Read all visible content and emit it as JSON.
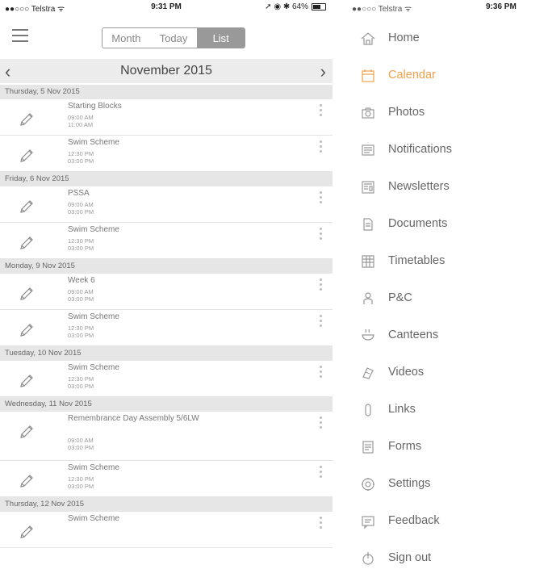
{
  "colors": {
    "accent": "#f0a04b",
    "header_bg": "#e6e6e6",
    "active_segment": "#999999"
  },
  "left": {
    "status": {
      "carrier": "●●○○○ Telstra ᯤ",
      "time": "9:31 PM",
      "right": "➚ ◉ ✱ 64%",
      "battery_level": 0.64
    },
    "segments": [
      {
        "label": "Month",
        "active": false
      },
      {
        "label": "Today",
        "active": false
      },
      {
        "label": "List",
        "active": true
      }
    ],
    "month": {
      "title": "November 2015",
      "prev": "‹",
      "next": "›"
    },
    "days": [
      {
        "header": "Thursday, 5 Nov 2015",
        "events": [
          {
            "title": "Starting Blocks",
            "start": "09:00 AM",
            "end": "11:00 AM"
          },
          {
            "title": "Swim Scheme",
            "start": "12:30 PM",
            "end": "03:00 PM"
          }
        ]
      },
      {
        "header": "Friday, 6 Nov 2015",
        "events": [
          {
            "title": "PSSA",
            "start": "09:00 AM",
            "end": "03:00 PM"
          },
          {
            "title": "Swim Scheme",
            "start": "12:30 PM",
            "end": "03:00 PM"
          }
        ]
      },
      {
        "header": "Monday, 9 Nov 2015",
        "events": [
          {
            "title": "Week 6",
            "start": "09:00 AM",
            "end": "03:00 PM"
          },
          {
            "title": "Swim Scheme",
            "start": "12:30 PM",
            "end": "03:00 PM"
          }
        ]
      },
      {
        "header": "Tuesday, 10 Nov 2015",
        "events": [
          {
            "title": "Swim Scheme",
            "start": "12:30 PM",
            "end": "03:00 PM"
          }
        ]
      },
      {
        "header": "Wednesday, 11 Nov 2015",
        "events": [
          {
            "title": "Remembrance Day Assembly 5/6LW",
            "start": "09:00 AM",
            "end": "03:00 PM",
            "tall": true
          },
          {
            "title": "Swim Scheme",
            "start": "12:30 PM",
            "end": "03:00 PM"
          }
        ]
      },
      {
        "header": "Thursday, 12 Nov 2015",
        "events": [
          {
            "title": "Swim Scheme",
            "start": "",
            "end": ""
          }
        ]
      }
    ]
  },
  "right": {
    "status": {
      "carrier": "●●○○○ Telstra ᯤ",
      "time": "9:36 PM"
    },
    "menu": [
      {
        "label": "Home",
        "icon": "home-icon",
        "active": false
      },
      {
        "label": "Calendar",
        "icon": "calendar-icon",
        "active": true
      },
      {
        "label": "Photos",
        "icon": "camera-icon",
        "active": false
      },
      {
        "label": "Notifications",
        "icon": "notifications-icon",
        "active": false
      },
      {
        "label": "Newsletters",
        "icon": "newsletter-icon",
        "active": false
      },
      {
        "label": "Documents",
        "icon": "document-icon",
        "active": false
      },
      {
        "label": "Timetables",
        "icon": "timetable-icon",
        "active": false
      },
      {
        "label": "P&C",
        "icon": "people-icon",
        "active": false
      },
      {
        "label": "Canteens",
        "icon": "canteen-icon",
        "active": false
      },
      {
        "label": "Videos",
        "icon": "video-icon",
        "active": false
      },
      {
        "label": "Links",
        "icon": "link-icon",
        "active": false
      },
      {
        "label": "Forms",
        "icon": "form-icon",
        "active": false
      },
      {
        "label": "Settings",
        "icon": "settings-icon",
        "active": false
      },
      {
        "label": "Feedback",
        "icon": "feedback-icon",
        "active": false
      },
      {
        "label": "Sign out",
        "icon": "sign-out-icon",
        "active": false
      }
    ]
  }
}
